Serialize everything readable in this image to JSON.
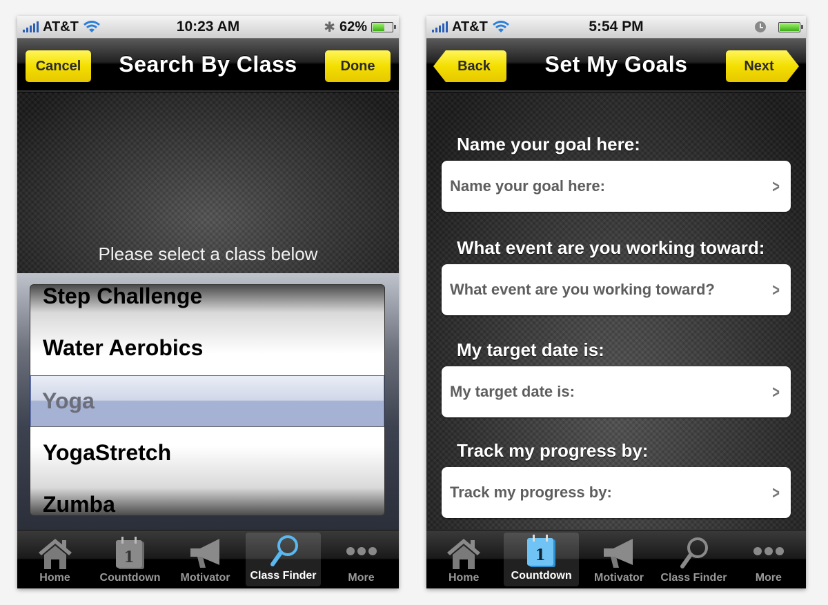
{
  "left_screen": {
    "status_bar": {
      "carrier": "AT&T",
      "time": "10:23 AM",
      "battery_percent_label": "62%",
      "battery_level": 0.62,
      "icons": [
        "signal-icon",
        "wifi-icon",
        "bluetooth-icon",
        "battery-icon"
      ]
    },
    "nav": {
      "title": "Search By Class",
      "left_button": "Cancel",
      "right_button": "Done"
    },
    "hint": "Please select a class below",
    "picker": {
      "items": [
        "Step Challenge",
        "Water Aerobics",
        "Yoga",
        "YogaStretch",
        "Zumba"
      ],
      "selected": "Yoga"
    },
    "tabs": [
      {
        "label": "Home",
        "icon": "house-icon",
        "active": false
      },
      {
        "label": "Countdown",
        "icon": "calendar-icon",
        "active": false
      },
      {
        "label": "Motivator",
        "icon": "megaphone-icon",
        "active": false
      },
      {
        "label": "Class Finder",
        "icon": "magnifier-icon",
        "active": true
      },
      {
        "label": "More",
        "icon": "more-dots-icon",
        "active": false
      }
    ],
    "calendar_day": "1"
  },
  "right_screen": {
    "status_bar": {
      "carrier": "AT&T",
      "time": "5:54 PM",
      "battery_level": 1.0,
      "icons": [
        "signal-icon",
        "wifi-icon",
        "alarm-icon",
        "battery-icon"
      ]
    },
    "nav": {
      "title": "Set My Goals",
      "left_button": "Back",
      "right_button": "Next"
    },
    "fields": [
      {
        "label": "Name your goal here:",
        "placeholder": "Name your goal here:"
      },
      {
        "label": "What event are you working toward:",
        "placeholder": "What event are you working toward?"
      },
      {
        "label": "My target date is:",
        "placeholder": "My target date is:"
      },
      {
        "label": "Track my progress by:",
        "placeholder": "Track my progress by:"
      }
    ],
    "tabs": [
      {
        "label": "Home",
        "icon": "house-icon",
        "active": false
      },
      {
        "label": "Countdown",
        "icon": "calendar-icon",
        "active": true
      },
      {
        "label": "Motivator",
        "icon": "megaphone-icon",
        "active": false
      },
      {
        "label": "Class Finder",
        "icon": "magnifier-icon",
        "active": false
      },
      {
        "label": "More",
        "icon": "more-dots-icon",
        "active": false
      }
    ],
    "calendar_day": "1"
  },
  "colors": {
    "accent_yellow": "#f3df00",
    "active_tab_blue": "#5ab8f0",
    "picker_selection": "#96a4cd"
  }
}
